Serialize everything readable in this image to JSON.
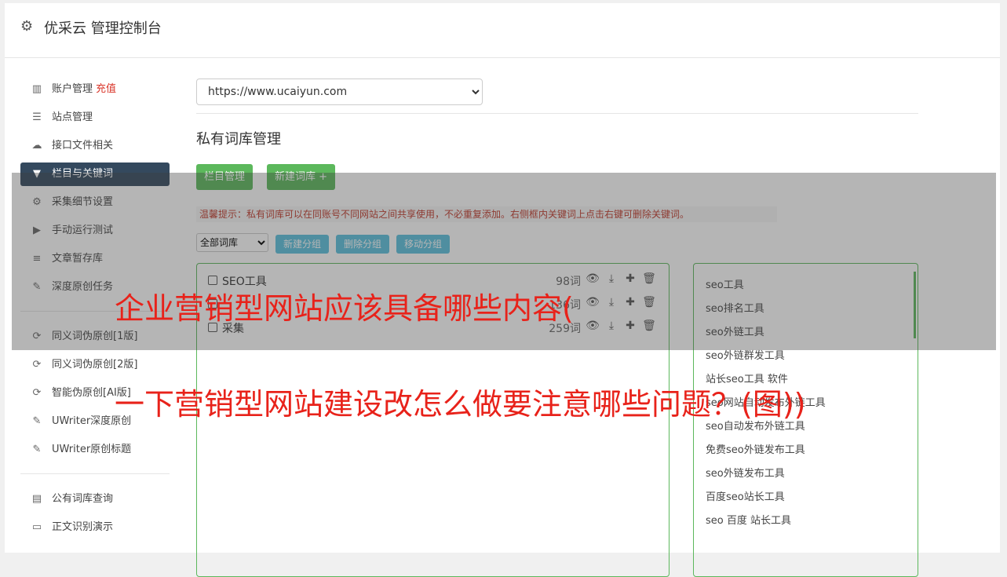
{
  "app": {
    "title": "优采云 管理控制台"
  },
  "sidebar": {
    "items": [
      {
        "label": "账户管理",
        "badge": "充值",
        "icon": "bar-chart-icon"
      },
      {
        "label": "站点管理",
        "icon": "server-icon"
      },
      {
        "label": "接口文件相关",
        "icon": "cloud-upload-icon"
      },
      {
        "label": "栏目与关键词",
        "icon": "filter-icon"
      },
      {
        "label": "采集细节设置",
        "icon": "cogs-icon"
      },
      {
        "label": "手动运行测试",
        "icon": "play-circle-icon"
      },
      {
        "label": "文章暂存库",
        "icon": "database-icon"
      },
      {
        "label": "深度原创任务",
        "icon": "edit-icon"
      }
    ],
    "items2": [
      {
        "label": "同义词伪原创[1版]",
        "icon": "refresh-icon"
      },
      {
        "label": "同义词伪原创[2版]",
        "icon": "refresh-icon"
      },
      {
        "label": "智能伪原创[AI版]",
        "icon": "refresh-icon"
      },
      {
        "label": "UWriter深度原创",
        "icon": "edit-icon"
      },
      {
        "label": "UWriter原创标题",
        "icon": "edit-icon"
      }
    ],
    "items3": [
      {
        "label": "公有词库查询",
        "icon": "book-icon"
      },
      {
        "label": "正文识别演示",
        "icon": "monitor-icon"
      }
    ]
  },
  "main": {
    "site_select": "https://www.ucaiyun.com",
    "section_title": "私有词库管理",
    "btn_columns": "栏目管理",
    "btn_new_lib": "新建词库 +",
    "tip": "温馨提示：私有词库可以在同账号不同网站之间共享使用，不必重复添加。右侧框内关键词上点击右键可删除关键词。",
    "group_select": "全部词库",
    "btn_new_group": "新建分组",
    "btn_del_group": "删除分组",
    "btn_move_group": "移动分组",
    "libraries": [
      {
        "name": "SEO工具",
        "count": "98词"
      },
      {
        "name": "",
        "count": "136词"
      },
      {
        "name": "采集",
        "count": "259词"
      }
    ],
    "keywords": [
      "seo工具",
      "seo排名工具",
      "seo外链工具",
      "seo外链群发工具",
      "站长seo工具 软件",
      "seo网站自动发布外链工具",
      "seo自动发布外链工具",
      "免费seo外链发布工具",
      "seo外链发布工具",
      "百度seo站长工具",
      "seo 百度 站长工具"
    ]
  },
  "overlay": {
    "line1": "企业营销型网站应该具备哪些内容(",
    "line2": "一下营销型网站建设改怎么做要注意哪些问题？(图))"
  },
  "colors": {
    "green": "#5cb85c",
    "blue": "#5bc0de",
    "headline": "#e8221a",
    "active_nav": "#34495e"
  }
}
